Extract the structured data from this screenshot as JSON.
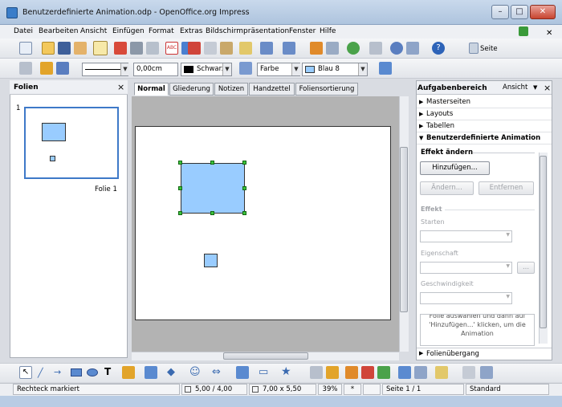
{
  "window": {
    "title": "Benutzerdefinierte Animation.odp - OpenOffice.org Impress",
    "minimize": "–",
    "maximize": "□",
    "close": "✕"
  },
  "menu": [
    "Datei",
    "Bearbeiten",
    "Ansicht",
    "Einfügen",
    "Format",
    "Extras",
    "Bildschirmpräsentation",
    "Fenster",
    "Hilfe"
  ],
  "toolbar": {
    "seite_label": "Seite"
  },
  "format_bar": {
    "line_width": "0,00cm",
    "line_color": "Schwarz",
    "fill_type": "Farbe",
    "fill_color": "Blau 8"
  },
  "slides_panel": {
    "title": "Folien",
    "close": "×",
    "slide_number": "1",
    "slide_label": "Folie 1"
  },
  "view_tabs": [
    "Normal",
    "Gliederung",
    "Notizen",
    "Handzettel",
    "Foliensortierung"
  ],
  "task_pane": {
    "title": "Aufgabenbereich",
    "view_menu": "Ansicht",
    "close": "×",
    "sections": [
      "Masterseiten",
      "Layouts",
      "Tabellen",
      "Benutzerdefinierte Animation"
    ],
    "effect_change_heading": "Effekt ändern",
    "add_button": "Hinzufügen...",
    "change_button": "Ändern...",
    "remove_button": "Entfernen",
    "effect_heading": "Effekt",
    "start_label": "Starten",
    "property_label": "Eigenschaft",
    "speed_label": "Geschwindigkeit",
    "more_button": "...",
    "hint_text": "Folie auswählen und dann auf 'Hinzufügen...' klicken, um die Animation",
    "transition_section": "Folienübergang"
  },
  "status": {
    "message": "Rechteck markiert",
    "position": "5,00 / 4,00",
    "size": "7,00 x 5,50",
    "zoom": "39%",
    "modified": "*",
    "page": "Seite 1 / 1",
    "layout": "Standard"
  },
  "colors": {
    "shape_fill": "#99ccff",
    "selection_handle": "#3cc33c"
  }
}
